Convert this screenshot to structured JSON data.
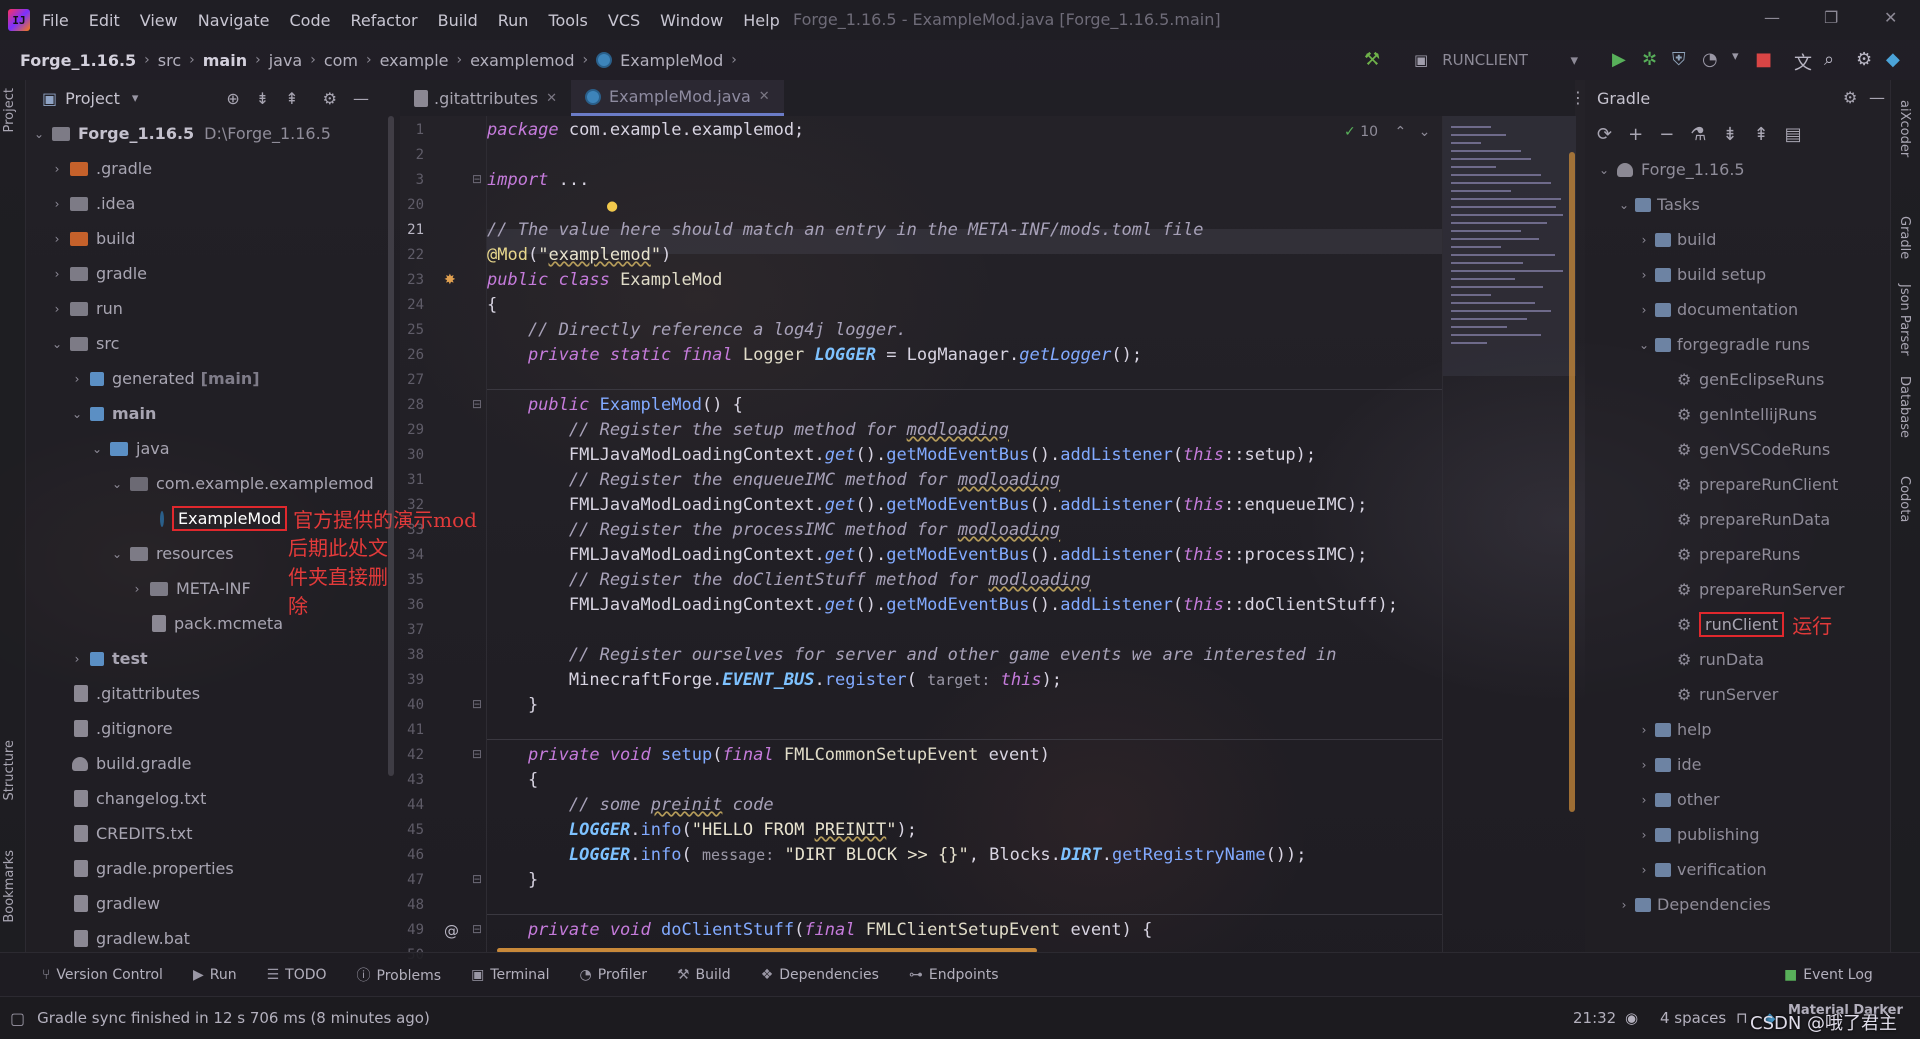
{
  "menu": {
    "items": [
      "File",
      "Edit",
      "View",
      "Navigate",
      "Code",
      "Refactor",
      "Build",
      "Run",
      "Tools",
      "VCS",
      "Window",
      "Help"
    ],
    "title": "Forge_1.16.5 - ExampleMod.java [Forge_1.16.5.main]"
  },
  "nav": {
    "crumbs": [
      "Forge_1.16.5",
      "src",
      "main",
      "java",
      "com",
      "example",
      "examplemod",
      "ExampleMod"
    ],
    "run_config": "RUNCLIENT"
  },
  "project": {
    "title": "Project",
    "tree": [
      {
        "label": "Forge_1.16.5",
        "extra": "D:\\Forge_1.16.5"
      },
      {
        "label": ".gradle"
      },
      {
        "label": ".idea"
      },
      {
        "label": "build"
      },
      {
        "label": "gradle"
      },
      {
        "label": "run"
      },
      {
        "label": "src"
      },
      {
        "label": "generated",
        "hint": "[main]"
      },
      {
        "label": "main"
      },
      {
        "label": "java"
      },
      {
        "label": "com.example.examplemod"
      },
      {
        "label": "ExampleMod"
      },
      {
        "label": "resources"
      },
      {
        "label": "META-INF"
      },
      {
        "label": "pack.mcmeta"
      },
      {
        "label": "test"
      },
      {
        "label": ".gitattributes"
      },
      {
        "label": ".gitignore"
      },
      {
        "label": "build.gradle"
      },
      {
        "label": "changelog.txt"
      },
      {
        "label": "CREDITS.txt"
      },
      {
        "label": "gradle.properties"
      },
      {
        "label": "gradlew"
      },
      {
        "label": "gradlew.bat"
      }
    ],
    "annotation_line1": "官方提供的演示mod",
    "annotation_line2": "后期此处文件夹直接删除"
  },
  "tabs": [
    {
      "label": ".gitattributes"
    },
    {
      "label": "ExampleMod.java"
    }
  ],
  "editor": {
    "inspection_count": "10",
    "line_numbers": [
      "1",
      "2",
      "3",
      "20",
      "21",
      "22",
      "23",
      "24",
      "25",
      "26",
      "27",
      "28",
      "29",
      "30",
      "31",
      "32",
      "33",
      "34",
      "35",
      "36",
      "37",
      "38",
      "39",
      "40",
      "41",
      "42",
      "43",
      "44",
      "45",
      "46",
      "47",
      "48",
      "49",
      "50"
    ]
  },
  "gradle": {
    "title": "Gradle",
    "tree": [
      {
        "label": "Forge_1.16.5"
      },
      {
        "label": "Tasks"
      },
      {
        "label": "build"
      },
      {
        "label": "build setup"
      },
      {
        "label": "documentation"
      },
      {
        "label": "forgegradle runs"
      },
      {
        "label": "genEclipseRuns"
      },
      {
        "label": "genIntellijRuns"
      },
      {
        "label": "genVSCodeRuns"
      },
      {
        "label": "prepareRunClient"
      },
      {
        "label": "prepareRunData"
      },
      {
        "label": "prepareRuns"
      },
      {
        "label": "prepareRunServer"
      },
      {
        "label": "runClient"
      },
      {
        "label": "runData"
      },
      {
        "label": "runServer"
      },
      {
        "label": "help"
      },
      {
        "label": "ide"
      },
      {
        "label": "other"
      },
      {
        "label": "publishing"
      },
      {
        "label": "verification"
      },
      {
        "label": "Dependencies"
      }
    ],
    "annotation": "运行"
  },
  "rightstrip": [
    "aiXcoder",
    "Gradle",
    "Json Parser",
    "Database",
    "Codota"
  ],
  "leftstrip": [
    "Project",
    "Structure",
    "Bookmarks"
  ],
  "bottom_tools": [
    "Version Control",
    "Run",
    "TODO",
    "Problems",
    "Terminal",
    "Profiler",
    "Build",
    "Dependencies",
    "Endpoints",
    "Event Log"
  ],
  "status": {
    "message": "Gradle sync finished in 12 s 706 ms (8 minutes ago)",
    "position": "21:32",
    "indent": "4 spaces",
    "theme": "Material Darker",
    "watermark": "CSDN @哦了君主"
  }
}
